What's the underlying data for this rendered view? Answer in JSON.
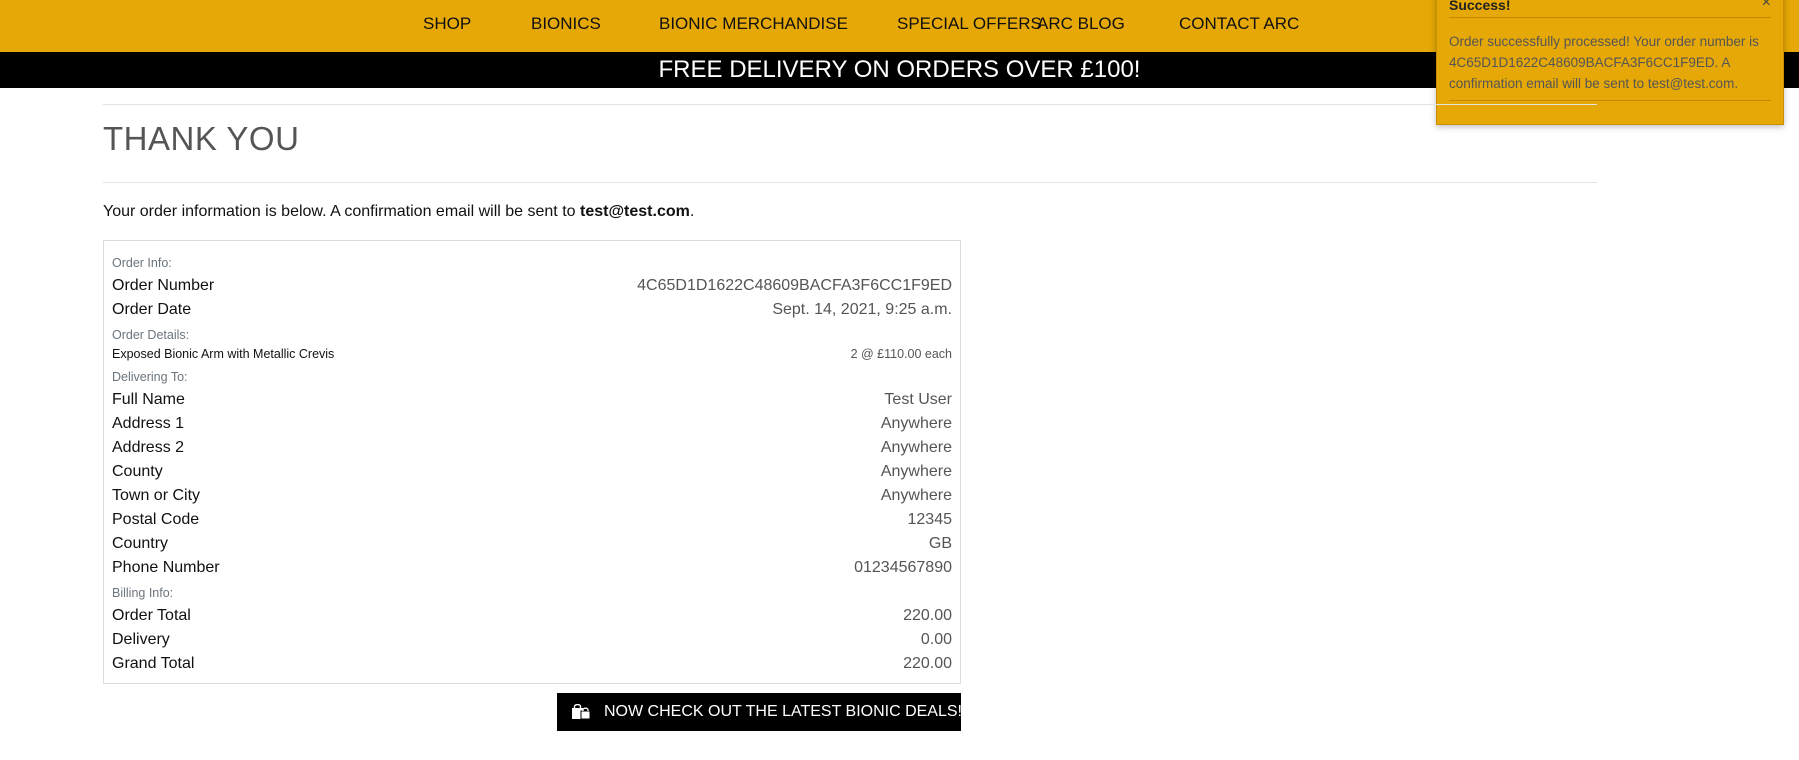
{
  "nav": {
    "items": [
      {
        "label": "SHOP"
      },
      {
        "label": "BIONICS"
      },
      {
        "label": "BIONIC MERCHANDISE"
      },
      {
        "label": "SPECIAL OFFERS"
      },
      {
        "label": "ARC BLOG"
      },
      {
        "label": "CONTACT ARC"
      }
    ]
  },
  "banner": {
    "text": "FREE DELIVERY ON ORDERS OVER £100!"
  },
  "toast": {
    "title": "Success!",
    "close": "×",
    "message": "Order successfully processed! Your order number is 4C65D1D1622C48609BACFA3F6CC1F9ED. A confirmation email will be sent to test@test.com."
  },
  "page": {
    "title": "THANK YOU",
    "intro_text": "Your order information is below. A confirmation email will be sent to ",
    "intro_email": "test@test.com",
    "intro_end": "."
  },
  "order": {
    "sections": {
      "order_info": "Order Info:",
      "order_details": "Order Details:",
      "delivering_to": "Delivering To:",
      "billing_info": "Billing Info:"
    },
    "info": [
      {
        "label": "Order Number",
        "value": "4C65D1D1622C48609BACFA3F6CC1F9ED"
      },
      {
        "label": "Order Date",
        "value": "Sept. 14, 2021, 9:25 a.m."
      }
    ],
    "items": [
      {
        "name": "Exposed Bionic Arm with Metallic Crevis",
        "qty_price": "2 @ £110.00 each"
      }
    ],
    "delivery": [
      {
        "label": "Full Name",
        "value": "Test User"
      },
      {
        "label": "Address 1",
        "value": "Anywhere"
      },
      {
        "label": "Address 2",
        "value": "Anywhere"
      },
      {
        "label": "County",
        "value": "Anywhere"
      },
      {
        "label": "Town or City",
        "value": "Anywhere"
      },
      {
        "label": "Postal Code",
        "value": "12345"
      },
      {
        "label": "Country",
        "value": "GB"
      },
      {
        "label": "Phone Number",
        "value": "01234567890"
      }
    ],
    "billing": [
      {
        "label": "Order Total",
        "value": "220.00"
      },
      {
        "label": "Delivery",
        "value": "0.00"
      },
      {
        "label": "Grand Total",
        "value": "220.00"
      }
    ]
  },
  "cta": {
    "label": "NOW CHECK OUT THE LATEST BIONIC DEALS!",
    "icon": "shopping-bags-icon"
  },
  "colors": {
    "brand_yellow": "#e5a806",
    "banner_black": "#000000"
  }
}
